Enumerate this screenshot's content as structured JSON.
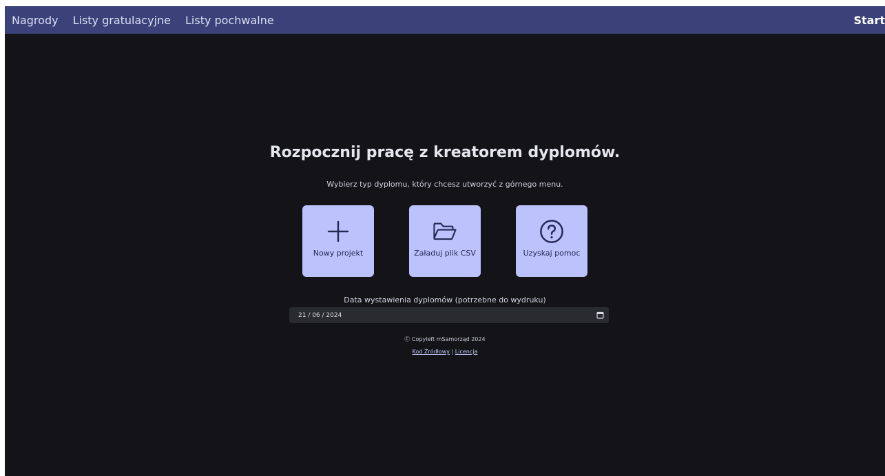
{
  "nav": {
    "items": [
      {
        "label": "Nagrody"
      },
      {
        "label": "Listy gratulacyjne"
      },
      {
        "label": "Listy pochwalne"
      }
    ],
    "brand": "Start"
  },
  "main": {
    "title": "Rozpocznij pracę z kreatorem dyplomów.",
    "subtitle": "Wybierz typ dyplomu, który chcesz utworzyć z górnego menu.",
    "cards": [
      {
        "icon": "plus-icon",
        "label": "Nowy projekt"
      },
      {
        "icon": "folder-open-icon",
        "label": "Załaduj plik CSV"
      },
      {
        "icon": "help-circle-icon",
        "label": "Uzyskaj pomoc"
      }
    ],
    "date_label": "Data wystawienia dyplomów (potrzebne do wydruku)",
    "date_value": "21 / 06 / 2024"
  },
  "footer": {
    "copyright": "Ⓒ Copyleft mSamorząd 2024",
    "source_link": "Kod Źródłowy",
    "separator": "|",
    "license_link": "Licencja"
  },
  "colors": {
    "background": "#131318",
    "topbar": "#3b4279",
    "card": "#bcc2fb",
    "card_text": "#252a55"
  }
}
